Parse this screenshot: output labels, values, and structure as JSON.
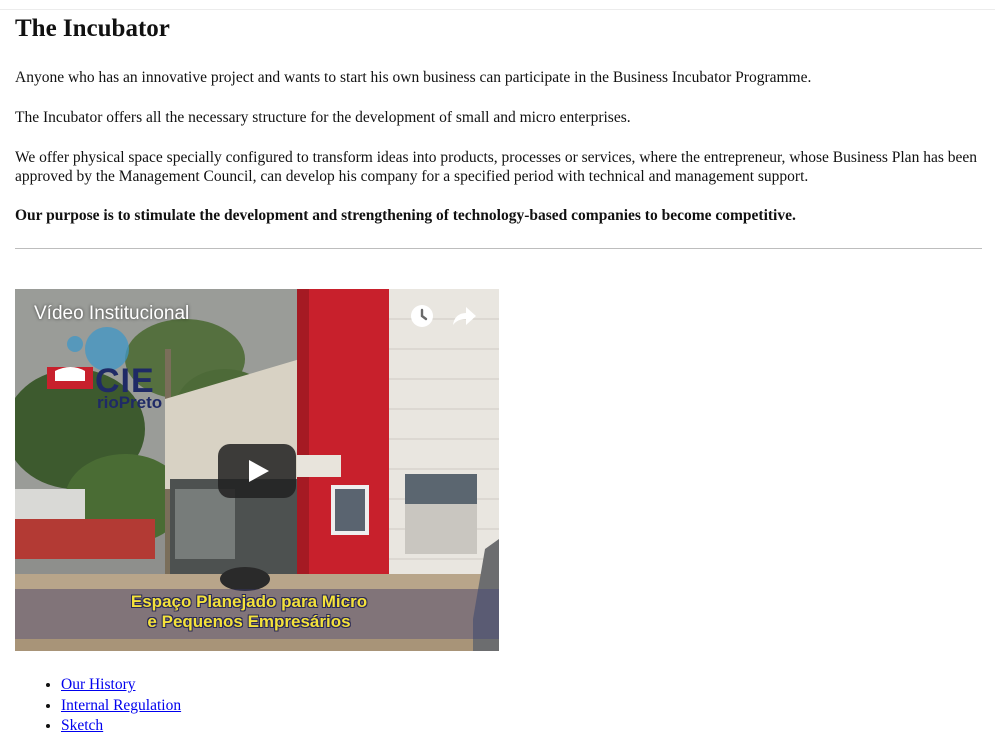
{
  "page": {
    "title": "The Incubator",
    "paragraphs": [
      "Anyone who has an innovative project and wants to start his own business can participate in the Business Incubator Programme.",
      "The Incubator offers all the necessary structure for the development of small and micro enterprises.",
      "We offer physical space specially configured to transform ideas into products, processes or services, where the entrepreneur, whose Business Plan has been approved by the Management Council, can develop his company for a specified period with technical and management support.",
      "Our purpose is to stimulate the development and strengthening of technology-based companies to become competitive."
    ]
  },
  "video": {
    "title": "Vídeo Institucional",
    "caption_line1": "Espaço Planejado para Micro",
    "caption_line2": "e Pequenos Empresários",
    "logo_main": "CIE",
    "logo_sub": "rioPreto",
    "icons": [
      "clock-icon",
      "share-icon",
      "play-icon"
    ]
  },
  "links": [
    {
      "label": "Our History"
    },
    {
      "label": "Internal Regulation"
    },
    {
      "label": "Sketch"
    }
  ],
  "colors": {
    "link": "#0000ee",
    "caption_text": "#f4e23b",
    "building_red": "#c8202c"
  }
}
